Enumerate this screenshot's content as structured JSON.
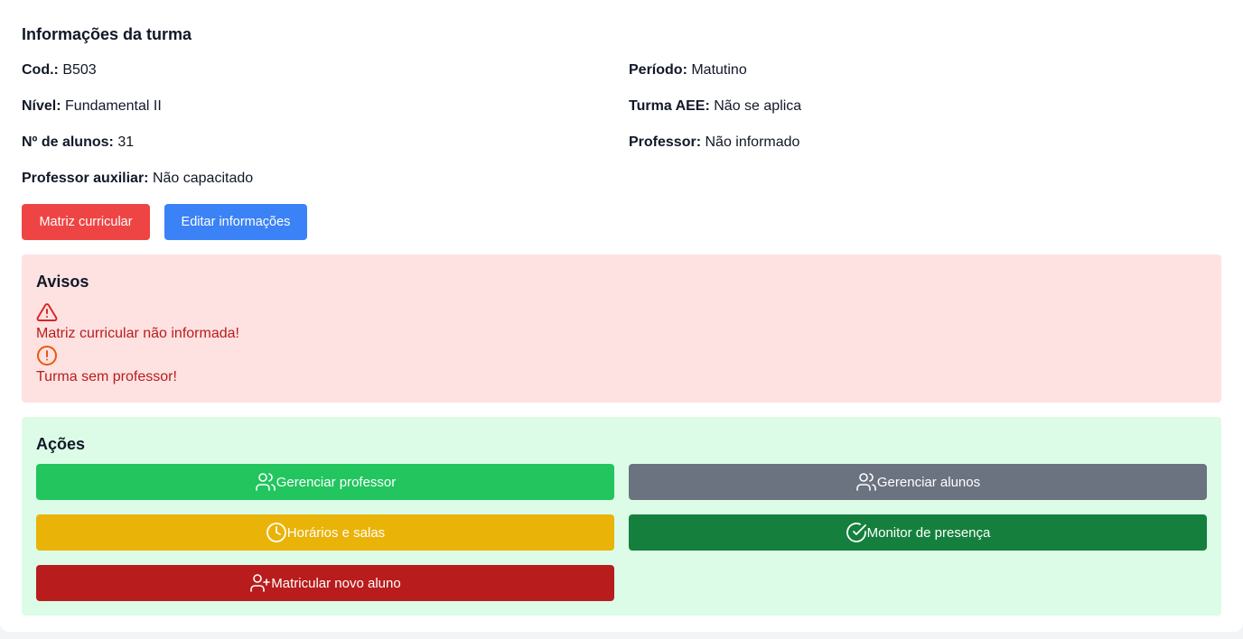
{
  "info": {
    "title": "Informações da turma",
    "fields": [
      {
        "label": "Cod.:",
        "value": "B503"
      },
      {
        "label": "Período:",
        "value": "Matutino"
      },
      {
        "label": "Nível:",
        "value": "Fundamental II"
      },
      {
        "label": "Turma AEE:",
        "value": "Não se aplica"
      },
      {
        "label": "Nº de alunos:",
        "value": "31"
      },
      {
        "label": "Professor:",
        "value": "Não informado"
      },
      {
        "label": "Professor auxiliar:",
        "value": "Não capacitado"
      }
    ],
    "buttons": {
      "matriz": "Matriz curricular",
      "editar": "Editar informações"
    },
    "colors": {
      "red": "#ef4444",
      "blue": "#3b82f6"
    }
  },
  "avisos": {
    "title": "Avisos",
    "items": [
      {
        "icon": "alert-triangle-icon",
        "text": "Matriz curricular não informada!",
        "icon_color": "#dc2626"
      },
      {
        "icon": "alert-circle-icon",
        "text": "Turma sem professor!",
        "icon_color": "#ea580c"
      }
    ]
  },
  "acoes": {
    "title": "Ações",
    "buttons": [
      {
        "label": "Gerenciar professor",
        "icon": "users-icon",
        "color": "#22c55e"
      },
      {
        "label": "Gerenciar alunos",
        "icon": "users-icon",
        "color": "#6b7280"
      },
      {
        "label": "Horários e salas",
        "icon": "clock-icon",
        "color": "#eab308"
      },
      {
        "label": "Monitor de presença",
        "icon": "check-circle-icon",
        "color": "#15803d"
      },
      {
        "label": "Matricular novo aluno",
        "icon": "user-plus-icon",
        "color": "#b91c1c"
      }
    ]
  }
}
